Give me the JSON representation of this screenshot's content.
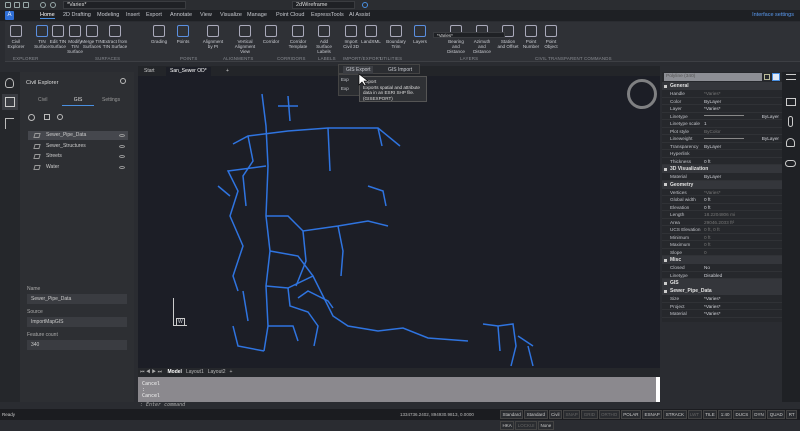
{
  "quick_access": {
    "view_dropdown": "*Varies*",
    "visual_style": "2dWireframe"
  },
  "menu": {
    "logo": "A",
    "tabs": [
      "Home",
      "2D Drafting",
      "Modeling",
      "Insert",
      "Export",
      "Annotate",
      "View",
      "Visualize",
      "Manage",
      "Point Cloud",
      "ExpressTools",
      "AI Assist"
    ],
    "interface_settings": "Interface settings"
  },
  "ribbon": {
    "buttons": [
      "Civil Explorer",
      "TIN Surface",
      "Edit TIN Surface",
      "Modify TIN Surface",
      "Merge TIN Surfaces",
      "Extract from TIN Surface",
      "Grading",
      "Points",
      "Alignment by PI",
      "Vertical Alignment View",
      "Corridor",
      "Corridor Template",
      "Add Surface Labels",
      "Import Civil 3D",
      "LandXML",
      "Boundary Trim",
      "Layers",
      "Bearing and Distance",
      "Azimuth and Distance",
      "Station and Offset",
      "Point Number",
      "Point Object"
    ],
    "import_icons": [
      "CIVIL 3D",
      "LAND XML"
    ],
    "layer_dropdown": "*Varies*",
    "panels": [
      "EXPLORER",
      "SURFACES",
      "POINTS",
      "ALIGNMENTS",
      "CORRIDORS",
      "LABELS",
      "IMPORT/EXPORT",
      "UTILITIES",
      "LAYERS",
      "CIVIL TRANSPARENT COMMANDS"
    ]
  },
  "flyout": {
    "gis_export": "GIS Export",
    "gis_import": "GIS Import",
    "item2": "Exp",
    "item3": "Exp",
    "tooltip_title": "Export",
    "tooltip_body": "Exports spatial and attribute data in an ESRI SHP file. (GISEXPORT)"
  },
  "doc_tabs": [
    "Start",
    "San_Sewer OD*"
  ],
  "civil_explorer": {
    "title": "Civil Explorer",
    "tabs": [
      "Civil",
      "GIS",
      "Settings"
    ],
    "items": [
      {
        "label": "Sewer_Pipe_Data",
        "selected": true
      },
      {
        "label": "Sewer_Structures"
      },
      {
        "label": "Streets"
      },
      {
        "label": "Water"
      }
    ],
    "fields": [
      {
        "label": "Name",
        "value": "Sewer_Pipe_Data"
      },
      {
        "label": "Source",
        "value": "ImportMapGIS"
      },
      {
        "label": "Feature count",
        "value": "340"
      }
    ]
  },
  "layout_tabs": [
    "Model",
    "Layout1",
    "Layout2",
    "+"
  ],
  "command": {
    "history": [
      "Cancel",
      ":",
      "Cancel"
    ],
    "prompt": ": Enter command"
  },
  "ucs_label": "W",
  "status": {
    "left": "Ready",
    "coords": "1334736.2402, 894930.9813, 0.0000",
    "items": [
      {
        "t": "Standard",
        "on": true
      },
      {
        "t": "Standard",
        "on": true
      },
      {
        "t": "Civil",
        "on": true
      },
      {
        "t": "SNAP",
        "on": false
      },
      {
        "t": "GRID",
        "on": false
      },
      {
        "t": "ORTHO",
        "on": false
      },
      {
        "t": "POLAR",
        "on": true
      },
      {
        "t": "ESNAP",
        "on": true
      },
      {
        "t": "STRACK",
        "on": true
      },
      {
        "t": "LWT",
        "on": false
      },
      {
        "t": "TILE",
        "on": true
      },
      {
        "t": "1:40",
        "on": true
      },
      {
        "t": "DUCS",
        "on": true
      },
      {
        "t": "DYN",
        "on": true
      },
      {
        "t": "QUAD",
        "on": true
      },
      {
        "t": "RT",
        "on": true
      },
      {
        "t": "HKA",
        "on": true
      },
      {
        "t": "LOCKUI",
        "on": false
      },
      {
        "t": "None",
        "on": true
      }
    ]
  },
  "properties": {
    "selector": "Polyline (340)",
    "sections": [
      {
        "title": "General",
        "rows": [
          [
            "Handle",
            "*Varies*",
            1
          ],
          [
            "Color",
            "ByLayer",
            0
          ],
          [
            "Layer",
            "*Varies*",
            0
          ],
          [
            "Linetype",
            "ByLayer",
            0
          ],
          [
            "Linetype scale",
            "1",
            0
          ],
          [
            "Plot style",
            "ByColor",
            1
          ],
          [
            "Lineweight",
            "ByLayer",
            0
          ],
          [
            "Transparency",
            "ByLayer",
            0
          ],
          [
            "Hyperlink",
            "",
            0
          ],
          [
            "Thickness",
            "0 ft",
            0
          ]
        ]
      },
      {
        "title": "3D Visualization",
        "rows": [
          [
            "Material",
            "ByLayer",
            0
          ]
        ]
      },
      {
        "title": "Geometry",
        "rows": [
          [
            "Vertices",
            "*Varies*",
            1
          ],
          [
            "Global width",
            "0 ft",
            0
          ],
          [
            "Elevation",
            "0 ft",
            0
          ],
          [
            "Length",
            "18.2204806 mi",
            1
          ],
          [
            "Area",
            "29046.2033 ft²",
            1
          ],
          [
            "UCS Elevation",
            "0 ft, 0 ft",
            1
          ],
          [
            "  Minimum",
            "0 ft",
            1
          ],
          [
            "  Maximum",
            "0 ft",
            1
          ],
          [
            "Slope",
            "0",
            1
          ]
        ]
      },
      {
        "title": "Misc",
        "rows": [
          [
            "Closed",
            "No",
            0
          ],
          [
            "Linetype general",
            "Disabled",
            0
          ]
        ]
      },
      {
        "title": "GIS",
        "rows": []
      },
      {
        "title": "Sewer_Pipe_Data",
        "rows": [
          [
            "  Size",
            "*Varies*",
            0
          ],
          [
            "  Project",
            "*Varies*",
            0
          ],
          [
            "  Material",
            "*Varies*",
            0
          ]
        ]
      }
    ]
  },
  "colors": {
    "pipe": "#2f74e0",
    "accent": "#4a8fe0",
    "canvas": "#1c1e26"
  }
}
